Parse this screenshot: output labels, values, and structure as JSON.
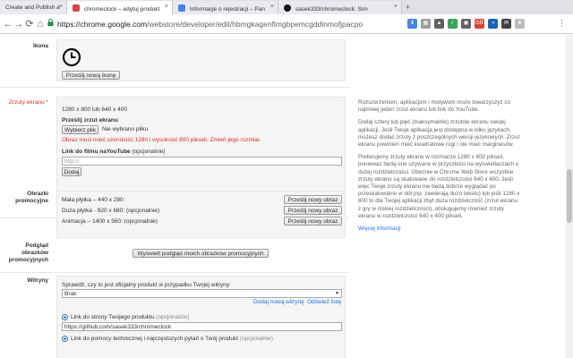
{
  "browser": {
    "tabs": [
      {
        "label": "Create and Publish a",
        "favicon_color": "#4285f4"
      },
      {
        "label": "chromeclock – edytuj produkt",
        "favicon_color": "#db4437"
      },
      {
        "label": "Informacje o rejestracji – Pan",
        "favicon_color": "#4285f4"
      },
      {
        "label": "sasek333/chromeclock: Sim",
        "favicon_color": "#111111"
      }
    ],
    "close_glyph": "×",
    "new_tab_glyph": "+",
    "url_host": "https://chrome.google.com",
    "url_path": "/webstore/developer/edit/hbmgkagenflmgbpemcgddinmofjpacpo",
    "icons": [
      "back-icon",
      "forward-icon",
      "reload-icon",
      "home-icon",
      "lock-icon"
    ],
    "nav_glyphs": {
      "back": "←",
      "forward": "→",
      "reload": "⟳",
      "home": "⌂",
      "lock": "🔒"
    },
    "extensions": [
      {
        "color": "#4285f4",
        "glyph": "⬇"
      },
      {
        "color": "#9e9e9e",
        "glyph": "▦"
      },
      {
        "color": "#616161",
        "glyph": "▲"
      },
      {
        "color": "#34a853",
        "glyph": "✓"
      },
      {
        "color": "#5f6368",
        "glyph": "◼"
      },
      {
        "color": "#db4437",
        "glyph": "GB"
      },
      {
        "color": "#1565c0",
        "glyph": "◑"
      },
      {
        "color": "#424242",
        "glyph": "✉"
      },
      {
        "color": "#bdbdbd",
        "glyph": "★"
      },
      {
        "color": "#9aa0a6",
        "glyph": "⋮"
      }
    ]
  },
  "icon_section": {
    "label": "Ikona",
    "upload_button": "Prześlij nową ikonę"
  },
  "screenshots": {
    "label": "Zrzuty ekranu *",
    "sizes": "1280 x 800 lub 640 x 400",
    "upload_title": "Prześlij zrzut ekranu",
    "choose_file": "Wybierz plik",
    "no_file": "Nie wybrano pliku",
    "error": "Obraz musi mieć szerokość 1280 i wysokość 800 pikseli. Zmień jego rozmiar.",
    "youtube_label": "Link do filmu naYouTube",
    "youtube_optional": "(opcjonalnie)",
    "youtube_placeholder": "http://",
    "add_button": "Dodaj"
  },
  "promo": {
    "label": "Obrazki promocyjne",
    "items": [
      {
        "text": "Mała płytka – 440 x 280:",
        "button": "Prześlij nowy obraz"
      },
      {
        "text": "Duża płytka - 920 x 680: (opcjonalnie)",
        "button": "Prześlij nowy obraz"
      },
      {
        "text": "Animacja – 1400 x 560: (opcjonalnie)",
        "button": "Prześlij nowy obraz"
      }
    ]
  },
  "preview": {
    "label": "Podgląd obrazków promocyjnych",
    "button": "Wyświetl podgląd moich obrazków promocyjnych"
  },
  "websites": {
    "label": "Witryny",
    "prompt": "Sprawdź, czy to jest oficjalny produkt w przypadku Twojej witryny:",
    "select_value": "Brak",
    "add_site": "Dodaj nową witrynę",
    "refresh": "Odśwież listę",
    "product_link_label": "Link do strony Twojego produktu",
    "optional": "(opcjonalnie)",
    "product_link_value": "https://github.com/sasek333/chromeclock",
    "support_link_label": "Link do pomocy technicznej i najczęstszych pytań o Twój produkt",
    "support_optional": "(opcjonalnie)"
  },
  "sidebar_help": {
    "p1": "Rozszerzeniom, aplikacjom i motywom może towarzyszyć co najmniej jeden zrzut ekranu lub link do YouTube.",
    "p2": "Dodaj cztery lub pięć (maksymalnie) zrzutów ekranu swojej aplikacji. Jeśli Twoja aplikacja jest dostępna w kilku językach, możesz dodać zrzuty z poszczególnych wersji językowych. Zrzut ekranu powinien mieć kwadratowe rogi i nie mieć marginesów.",
    "p3": "Preferujemy zrzuty ekranu w rozmiarze 1280 x 800 pikseli, ponieważ będą one używane w przyszłości na wyświetlaczach o dużej rozdzielczości. Obecnie w Chrome Web Store wszystkie zrzuty ekranu są skalowane do rozdzielczości 640 x 400. Jeśli więc Twoje zrzuty ekranu nie będą dobrze wyglądać po przeskalowaniu w dół (np. zawierają dużo tekstu) lub jeśli 1280 x 800 to dla Twojej aplikacji zbyt duża rozdzielczość (zrzut ekranu z gry w niskiej rozdzielczości), obsługujemy również zrzuty ekranu w rozdzielczości 640 x 400 pikseli.",
    "more_link": "Więcej informacji"
  }
}
